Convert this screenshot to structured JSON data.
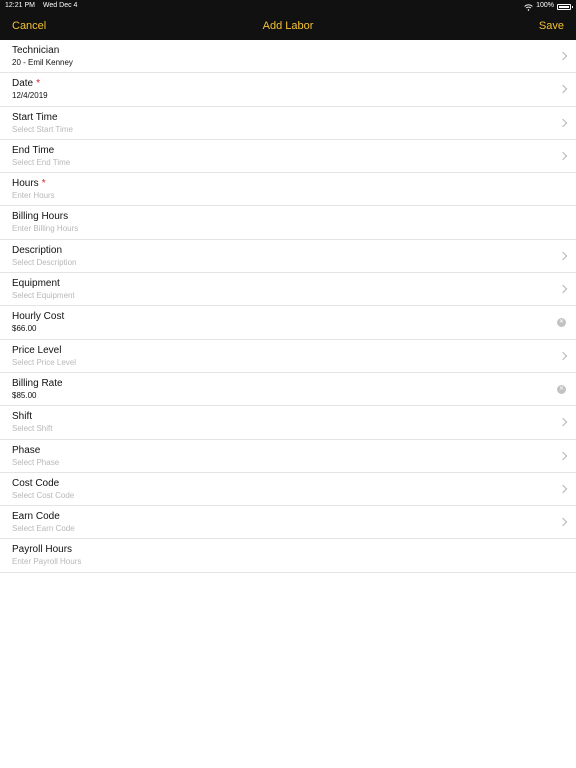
{
  "status_bar": {
    "time": "12:21 PM",
    "date": "Wed Dec 4",
    "battery": "100%"
  },
  "nav": {
    "cancel": "Cancel",
    "title": "Add Labor",
    "save": "Save"
  },
  "fields": [
    {
      "label": "Technician",
      "value": "20 - Emil Kenney",
      "placeholder": "",
      "required": false,
      "accessory": "chevron"
    },
    {
      "label": "Date",
      "value": "12/4/2019",
      "placeholder": "",
      "required": true,
      "accessory": "chevron"
    },
    {
      "label": "Start Time",
      "value": "",
      "placeholder": "Select Start Time",
      "required": false,
      "accessory": "chevron"
    },
    {
      "label": "End Time",
      "value": "",
      "placeholder": "Select End Time",
      "required": false,
      "accessory": "chevron"
    },
    {
      "label": "Hours",
      "value": "",
      "placeholder": "Enter Hours",
      "required": true,
      "accessory": "none"
    },
    {
      "label": "Billing Hours",
      "value": "",
      "placeholder": "Enter Billing Hours",
      "required": false,
      "accessory": "none"
    },
    {
      "label": "Description",
      "value": "",
      "placeholder": "Select Description",
      "required": false,
      "accessory": "chevron"
    },
    {
      "label": "Equipment",
      "value": "",
      "placeholder": "Select Equipment",
      "required": false,
      "accessory": "chevron"
    },
    {
      "label": "Hourly Cost",
      "value": "$66.00",
      "placeholder": "",
      "required": false,
      "accessory": "clear"
    },
    {
      "label": "Price Level",
      "value": "",
      "placeholder": "Select Price Level",
      "required": false,
      "accessory": "chevron"
    },
    {
      "label": "Billing Rate",
      "value": "$85.00",
      "placeholder": "",
      "required": false,
      "accessory": "clear"
    },
    {
      "label": "Shift",
      "value": "",
      "placeholder": "Select Shift",
      "required": false,
      "accessory": "chevron"
    },
    {
      "label": "Phase",
      "value": "",
      "placeholder": "Select Phase",
      "required": false,
      "accessory": "chevron"
    },
    {
      "label": "Cost Code",
      "value": "",
      "placeholder": "Select Cost Code",
      "required": false,
      "accessory": "chevron"
    },
    {
      "label": "Earn Code",
      "value": "",
      "placeholder": "Select Earn Code",
      "required": false,
      "accessory": "chevron"
    },
    {
      "label": "Payroll Hours",
      "value": "",
      "placeholder": "Enter Payroll Hours",
      "required": false,
      "accessory": "none"
    }
  ],
  "icons": {
    "row_chevron": "chevron-right-icon",
    "clear": "clear-circle-icon",
    "wifi": "wifi-icon",
    "battery": "battery-icon"
  },
  "colors": {
    "accent": "#f2c233",
    "bar_bg": "#111111",
    "required": "#d62121",
    "placeholder": "#b8b8b8"
  }
}
